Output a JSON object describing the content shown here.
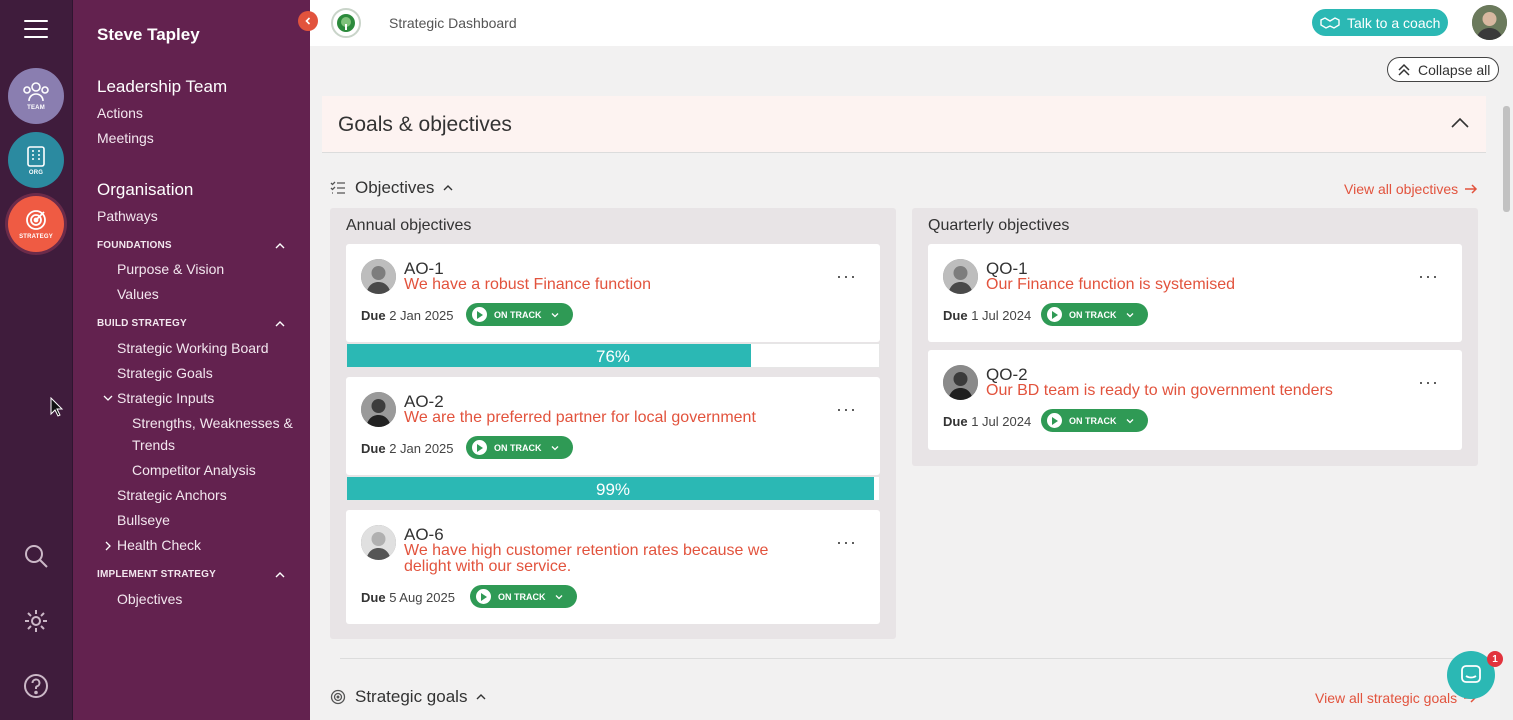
{
  "rail": {
    "apps": [
      {
        "label": "TEAM",
        "color": "#8a7eb0"
      },
      {
        "label": "ORG",
        "color": "#2b8aa0"
      },
      {
        "label": "STRATEGY",
        "color": "#ef5b43"
      }
    ]
  },
  "sidebar": {
    "user": "Steve Tapley",
    "team_heading": "Leadership Team",
    "team_links": [
      "Actions",
      "Meetings"
    ],
    "org_heading": "Organisation",
    "org_links": [
      "Pathways"
    ],
    "foundations": {
      "caption": "FOUNDATIONS",
      "items": [
        "Purpose & Vision",
        "Values"
      ]
    },
    "build_strategy": {
      "caption": "BUILD STRATEGY",
      "items": [
        "Strategic Working Board",
        "Strategic Goals",
        "Strategic Inputs"
      ],
      "inputs_children": [
        "Strengths, Weaknesses &",
        "Trends",
        "Competitor Analysis"
      ],
      "items_after": [
        "Strategic Anchors",
        "Bullseye",
        "Health Check"
      ]
    },
    "implement_strategy": {
      "caption": "IMPLEMENT STRATEGY",
      "items": [
        "Objectives"
      ]
    }
  },
  "topbar": {
    "title": "Strategic Dashboard",
    "coach_button": "Talk to a coach"
  },
  "main": {
    "collapse_all": "Collapse all",
    "goals_header": "Goals & objectives",
    "objectives_label": "Objectives",
    "view_all_objectives": "View all objectives",
    "strategic_goals_label": "Strategic goals",
    "view_all_goals": "View all strategic goals",
    "annual": {
      "title": "Annual objectives",
      "cards": [
        {
          "code": "AO-1",
          "desc": "We have a robust Finance function",
          "due_label": "Due",
          "due_date": "2 Jan 2025",
          "status": "ON TRACK",
          "progress_label": "76%",
          "progress": 0.76
        },
        {
          "code": "AO-2",
          "desc": "We are the preferred partner for local government",
          "due_label": "Due",
          "due_date": "2 Jan 2025",
          "status": "ON TRACK",
          "progress_label": "99%",
          "progress": 0.99
        },
        {
          "code": "AO-6",
          "desc": "We have high customer retention rates because we delight with our service.",
          "due_label": "Due",
          "due_date": "5 Aug 2025",
          "status": "ON TRACK"
        }
      ]
    },
    "quarterly": {
      "title": "Quarterly objectives",
      "cards": [
        {
          "code": "QO-1",
          "desc": "Our Finance function is systemised",
          "due_label": "Due",
          "due_date": "1 Jul 2024",
          "status": "ON TRACK"
        },
        {
          "code": "QO-2",
          "desc": "Our BD team is ready to win government tenders",
          "due_label": "Due",
          "due_date": "1 Jul 2024",
          "status": "ON TRACK"
        }
      ]
    }
  },
  "chat": {
    "badge": "1"
  },
  "colors": {
    "accent": "#e2533d",
    "teal": "#2bb8b4",
    "status_green": "#2f9a55",
    "sidebar": "#63224f",
    "rail": "#3f1c3c"
  }
}
